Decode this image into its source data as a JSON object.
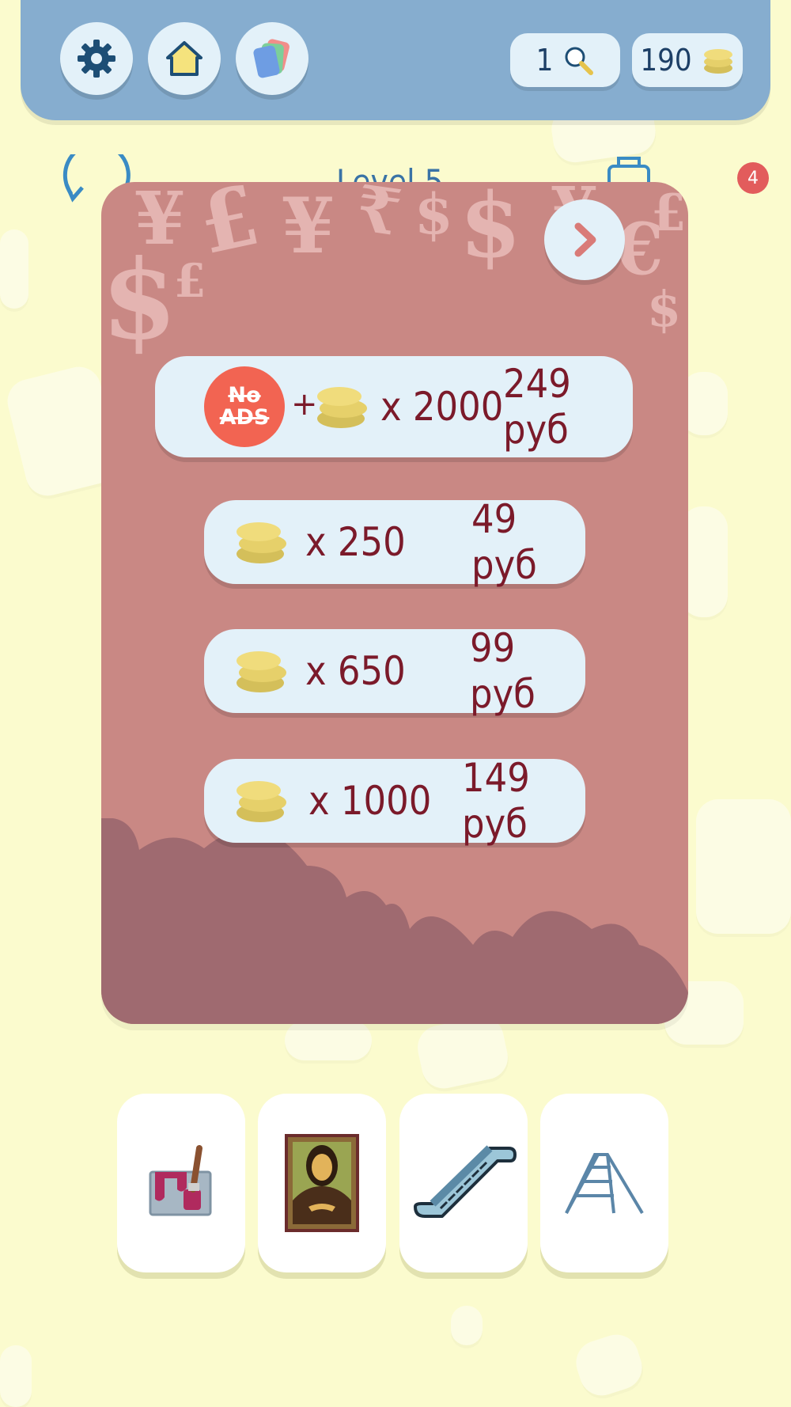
{
  "header": {
    "hints": {
      "count": "1",
      "icon": "magnifier-icon"
    },
    "coins": {
      "count": "190",
      "icon": "coins-icon"
    }
  },
  "level": {
    "label": "Level 5",
    "notification_count": "4"
  },
  "shop": {
    "decor_symbols": [
      "¥",
      "£",
      "¥",
      "₹",
      "$",
      "$",
      "¥",
      "€",
      "£",
      "$",
      "£",
      "$",
      "€"
    ],
    "offers": [
      {
        "no_ads": [
          "No",
          "ADS"
        ],
        "plus": "+",
        "quantity": "x 2000",
        "price": "249 руб"
      },
      {
        "quantity": "x 250",
        "price": "49 руб"
      },
      {
        "quantity": "x 650",
        "price": "99 руб"
      },
      {
        "quantity": "x 1000",
        "price": "149 руб"
      }
    ]
  },
  "items": [
    {
      "name": "paint-bucket"
    },
    {
      "name": "mona-lisa-painting"
    },
    {
      "name": "escalator"
    },
    {
      "name": "step-ladder"
    }
  ],
  "colors": {
    "background": "#fbfbce",
    "header": "#86adcf",
    "modal": "#c98884",
    "clouds": "#9f6a70",
    "button": "#e3f1f9",
    "price_text": "#7b1a2a",
    "no_ads": "#f26452"
  }
}
